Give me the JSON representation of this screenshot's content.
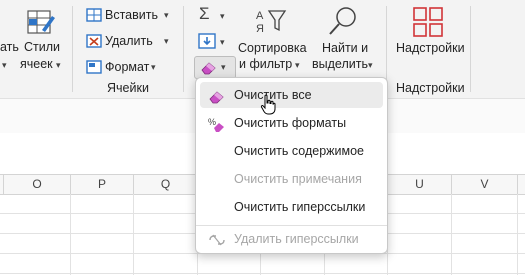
{
  "ribbon": {
    "partial_left_top": "ать",
    "partial_left_bottom": "▾",
    "styles_label_1": "Стили",
    "styles_label_2": "ячеек",
    "cells": {
      "insert": "Вставить",
      "delete": "Удалить",
      "format": "Формат",
      "group_label": "Ячейки"
    },
    "sort_label_1": "Сортировка",
    "sort_label_2": "и фильтр",
    "find_label_1": "Найти и",
    "find_label_2": "выделить",
    "addins_label": "Надстройки",
    "addins_group_label": "Надстройки"
  },
  "grid": {
    "columns": [
      "O",
      "P",
      "Q",
      "R",
      "S",
      "T",
      "U",
      "V"
    ]
  },
  "clear_menu": {
    "items": [
      {
        "label": "Очистить все",
        "state": "hover"
      },
      {
        "label": "Очистить форматы",
        "state": "normal"
      },
      {
        "label": "Очистить содержимое",
        "state": "normal"
      },
      {
        "label": "Очистить примечания",
        "state": "disabled"
      },
      {
        "label": "Очистить гиперссылки",
        "state": "normal"
      },
      {
        "label": "Удалить гиперссылки",
        "state": "disabled"
      }
    ]
  },
  "colors": {
    "accent": "#217346",
    "eraser": "#c94fc4",
    "addins": "#d13438"
  }
}
